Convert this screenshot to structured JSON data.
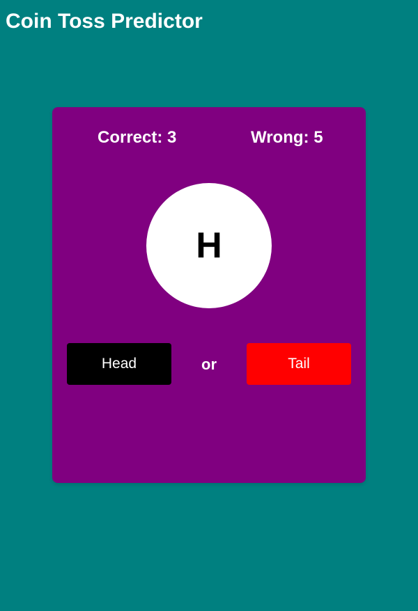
{
  "app": {
    "title": "Coin Toss Predictor"
  },
  "score": {
    "correct_label": "Correct: 3",
    "wrong_label": "Wrong: 5",
    "correct": 3,
    "wrong": 5
  },
  "coin": {
    "face": "H"
  },
  "choices": {
    "head_label": "Head",
    "or_label": "or",
    "tail_label": "Tail"
  },
  "colors": {
    "background": "#008080",
    "card": "#800080",
    "coin": "#ffffff",
    "head_button": "#000000",
    "tail_button": "#ff0000",
    "text": "#ffffff"
  }
}
